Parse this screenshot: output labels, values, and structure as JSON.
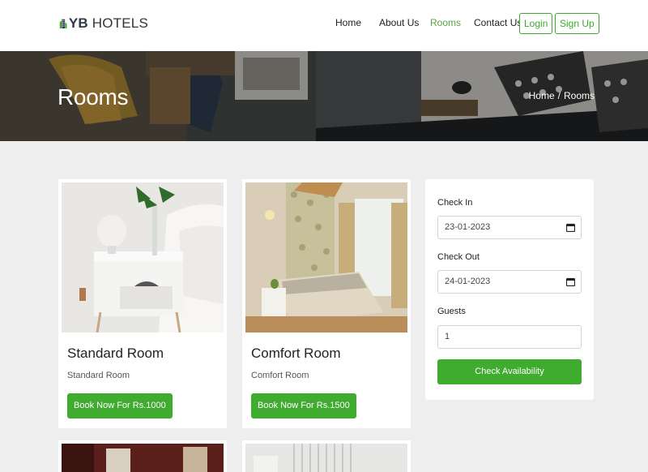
{
  "brand": {
    "bold": "YB",
    "rest": "HOTELS"
  },
  "nav": {
    "home": "Home",
    "about": "About Us",
    "rooms": "Rooms",
    "contact": "Contact Us",
    "login": "Login",
    "signup": "Sign Up",
    "active_color": "#56a43a"
  },
  "hero": {
    "title": "Rooms",
    "breadcrumb": {
      "home": "Home",
      "separator": "/",
      "current": "Rooms"
    }
  },
  "rooms": [
    {
      "title": "Standard Room",
      "subtitle": "Standard Room",
      "button": "Book Now For Rs.1000"
    },
    {
      "title": "Comfort Room",
      "subtitle": "Comfort Room",
      "button": "Book Now For Rs.1500"
    }
  ],
  "booking": {
    "check_in_label": "Check In",
    "check_in_value": "23-01-2023",
    "check_out_label": "Check Out",
    "check_out_value": "24-01-2023",
    "guests_label": "Guests",
    "guests_value": "1",
    "submit": "Check Availability"
  },
  "colors": {
    "accent": "#3fab2f"
  }
}
